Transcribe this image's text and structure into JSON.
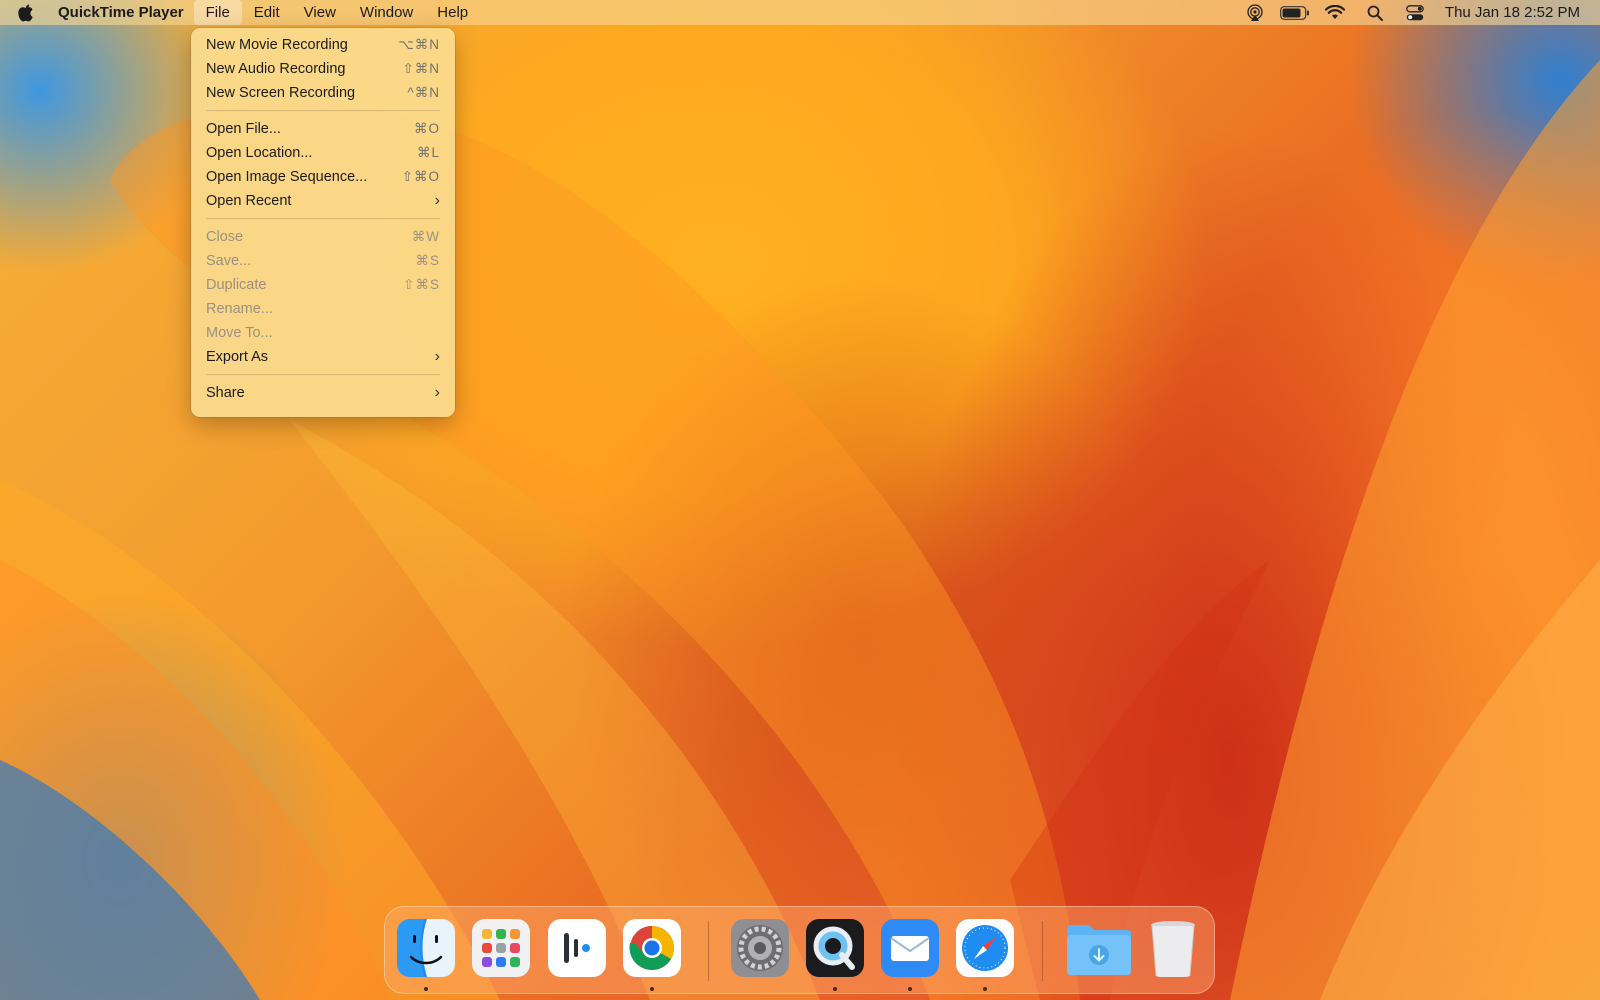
{
  "menubar": {
    "app_name": "QuickTime Player",
    "menus": [
      "File",
      "Edit",
      "View",
      "Window",
      "Help"
    ],
    "active_menu": "File",
    "clock": "Thu Jan 18  2:52 PM",
    "tray_icons": [
      "airplay-audio-icon",
      "battery-icon",
      "wifi-icon",
      "search-icon",
      "control-center-icon"
    ]
  },
  "file_menu": {
    "items": [
      {
        "label": "New Movie Recording",
        "shortcut": "⌥⌘N",
        "enabled": true
      },
      {
        "label": "New Audio Recording",
        "shortcut": "⇧⌘N",
        "enabled": true
      },
      {
        "label": "New Screen Recording",
        "shortcut": "^⌘N",
        "enabled": true
      },
      {
        "label": "Open File...",
        "shortcut": "⌘O",
        "enabled": true
      },
      {
        "label": "Open Location...",
        "shortcut": "⌘L",
        "enabled": true
      },
      {
        "label": "Open Image Sequence...",
        "shortcut": "⇧⌘O",
        "enabled": true
      },
      {
        "label": "Open Recent",
        "shortcut": "",
        "enabled": true,
        "submenu": true
      },
      {
        "label": "Close",
        "shortcut": "⌘W",
        "enabled": false
      },
      {
        "label": "Save...",
        "shortcut": "⌘S",
        "enabled": false
      },
      {
        "label": "Duplicate",
        "shortcut": "⇧⌘S",
        "enabled": false
      },
      {
        "label": "Rename...",
        "shortcut": "",
        "enabled": false
      },
      {
        "label": "Move To...",
        "shortcut": "",
        "enabled": false
      },
      {
        "label": "Export As",
        "shortcut": "",
        "enabled": true,
        "submenu": true
      },
      {
        "label": "Share",
        "shortcut": "",
        "enabled": true,
        "submenu": true
      }
    ]
  },
  "dock": {
    "apps": [
      {
        "name": "finder-icon",
        "running": true
      },
      {
        "name": "launchpad-icon",
        "running": false
      },
      {
        "name": "podcast-app-icon",
        "running": false
      },
      {
        "name": "chrome-icon",
        "running": true
      },
      {
        "name": "system-settings-icon",
        "running": false
      },
      {
        "name": "quicktime-icon",
        "running": true
      },
      {
        "name": "mail-icon",
        "running": true
      },
      {
        "name": "safari-icon",
        "running": true
      },
      {
        "name": "downloads-folder-icon",
        "running": false
      },
      {
        "name": "trash-icon",
        "running": false
      }
    ]
  },
  "colors": {
    "menu_bg": "#fae096",
    "disabled_text": "#9b9080",
    "accent_blue": "#1a73e8"
  }
}
